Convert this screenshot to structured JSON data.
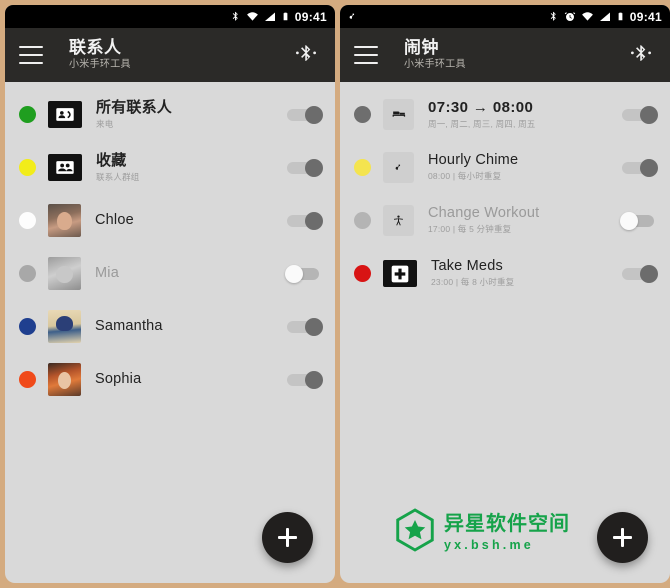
{
  "theme": {
    "border_color": "#d4ab80",
    "screen_bg": "#d9d9d9",
    "appbar_bg": "#2b2a28",
    "statusbar_bg": "#000000",
    "fab_bg": "#211f1e",
    "accent_watermark": "#16a34a"
  },
  "panels": [
    {
      "statusbar": {
        "time": "09:41",
        "left_icons": [],
        "right_icons": [
          "bluetooth-icon",
          "wifi-icon",
          "signal-icon",
          "battery-icon"
        ]
      },
      "appbar": {
        "menu_icon": "hamburger-icon",
        "title": "联系人",
        "subtitle": "小米手环工具",
        "action_icon": "bluetooth-searching-icon"
      },
      "rows": [
        {
          "dot_color": "#1f9e1f",
          "icon": "contact-card-icon",
          "icon_style": "dark",
          "title": "所有联系人",
          "title_cn": true,
          "subtitle": "来电",
          "switch": "on",
          "dim": false
        },
        {
          "dot_color": "#f2ec1a",
          "icon": "contacts-group-icon",
          "icon_style": "dark",
          "title": "收藏",
          "title_cn": true,
          "subtitle": "联系人群组",
          "switch": "on",
          "dim": false
        },
        {
          "dot_color": "#fdfdfd",
          "icon": "avatar-chloe",
          "icon_style": "avatar",
          "title": "Chloe",
          "title_cn": false,
          "subtitle": "",
          "switch": "on",
          "dim": false
        },
        {
          "dot_color": "#a8a8a8",
          "icon": "avatar-mia",
          "icon_style": "avatar",
          "title": "Mia",
          "title_cn": false,
          "subtitle": "",
          "switch": "off",
          "dim": true
        },
        {
          "dot_color": "#1f3f8f",
          "icon": "avatar-samantha",
          "icon_style": "avatar",
          "title": "Samantha",
          "title_cn": false,
          "subtitle": "",
          "switch": "on",
          "dim": false
        },
        {
          "dot_color": "#f04a1a",
          "icon": "avatar-sophia",
          "icon_style": "avatar",
          "title": "Sophia",
          "title_cn": false,
          "subtitle": "",
          "switch": "on",
          "dim": false
        }
      ],
      "fab": {
        "icon": "plus-icon",
        "label": "+"
      },
      "watermark": null
    },
    {
      "statusbar": {
        "time": "09:41",
        "left_icons": [
          "music-note-icon"
        ],
        "right_icons": [
          "bluetooth-icon",
          "alarm-clock-icon",
          "wifi-icon",
          "signal-icon",
          "battery-icon"
        ]
      },
      "appbar": {
        "menu_icon": "hamburger-icon",
        "title": "闹钟",
        "subtitle": "小米手环工具",
        "action_icon": "bluetooth-searching-icon"
      },
      "rows": [
        {
          "dot_color": "#6e6e6e",
          "icon": "bed-icon",
          "icon_style": "soft",
          "title": "07:30  →  08:00",
          "title_cn": false,
          "title_time": true,
          "subtitle": "周一, 周二, 周三, 周四, 周五",
          "switch": "on",
          "dim": false
        },
        {
          "dot_color": "#f4e44f",
          "icon": "music-note-icon",
          "icon_style": "soft",
          "title": "Hourly Chime",
          "title_cn": false,
          "subtitle": "08:00 | 每小时重复",
          "switch": "on",
          "dim": false
        },
        {
          "dot_color": "#b4b4b4",
          "icon": "workout-person-icon",
          "icon_style": "soft",
          "title": "Change Workout",
          "title_cn": false,
          "subtitle": "17:00 | 每 5 分钟重复",
          "switch": "off",
          "dim": true
        },
        {
          "dot_color": "#d81414",
          "icon": "medical-cross-icon",
          "icon_style": "dark",
          "title": "Take Meds",
          "title_cn": false,
          "subtitle": "23:00 | 每 8 小时重复",
          "switch": "on",
          "dim": false
        }
      ],
      "fab": {
        "icon": "plus-icon",
        "label": "+"
      },
      "watermark": {
        "logo_icon": "star-hexagon-logo",
        "name": "异星软件空间",
        "url": "yx.bsh.me"
      }
    }
  ]
}
